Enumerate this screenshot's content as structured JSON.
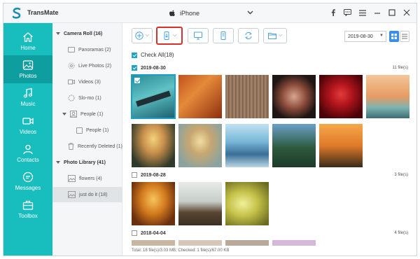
{
  "app": {
    "name": "TransMate",
    "device": "iPhone"
  },
  "window_controls": [
    "facebook-icon",
    "feedback-icon",
    "menu-icon",
    "minimize-icon",
    "maximize-icon",
    "close-icon"
  ],
  "sidebar": {
    "items": [
      {
        "label": "Home",
        "icon": "home-icon"
      },
      {
        "label": "Photos",
        "icon": "photos-icon",
        "active": true
      },
      {
        "label": "Music",
        "icon": "music-icon"
      },
      {
        "label": "Videos",
        "icon": "videos-icon"
      },
      {
        "label": "Contacts",
        "icon": "contacts-icon"
      },
      {
        "label": "Messages",
        "icon": "messages-icon"
      },
      {
        "label": "Toolbox",
        "icon": "toolbox-icon"
      }
    ]
  },
  "tree": {
    "camera_roll": "Camera Roll (16)",
    "panoramas": "Panoramas (2)",
    "live_photos": "Live Photos (2)",
    "videos": "Videos (3)",
    "slo_mo": "Slo-mo (1)",
    "people_group": "People (1)",
    "people": "People (1)",
    "recently_deleted": "Recently Deleted (1)",
    "photo_library": "Photo Library (41)",
    "flowers": "flowers (4)",
    "just_do_it": "just do it (18)"
  },
  "toolbar": {
    "buttons": [
      "add-icon",
      "export-to-device-icon",
      "export-to-pc-icon",
      "delete-icon",
      "convert-icon",
      "folder-icon"
    ],
    "date_value": "2019-08-30"
  },
  "check_all_label": "Check All(18)",
  "groups": [
    {
      "date": "2019-08-30",
      "count": "11 file(s)",
      "checked": true
    },
    {
      "date": "2019-08-28",
      "count": "3 file(s)",
      "checked": false
    },
    {
      "date": "2018-04-04",
      "count": "4 file(s)",
      "checked": false
    }
  ],
  "status": "Total: 18 file(s)/3.03 MB; Checked: 1 file(s)/67.00 KB",
  "colors": {
    "accent": "#18bdbd",
    "accent_dark": "#0e9ea0",
    "highlight": "#d9302c",
    "check": "#1aa0c4"
  }
}
